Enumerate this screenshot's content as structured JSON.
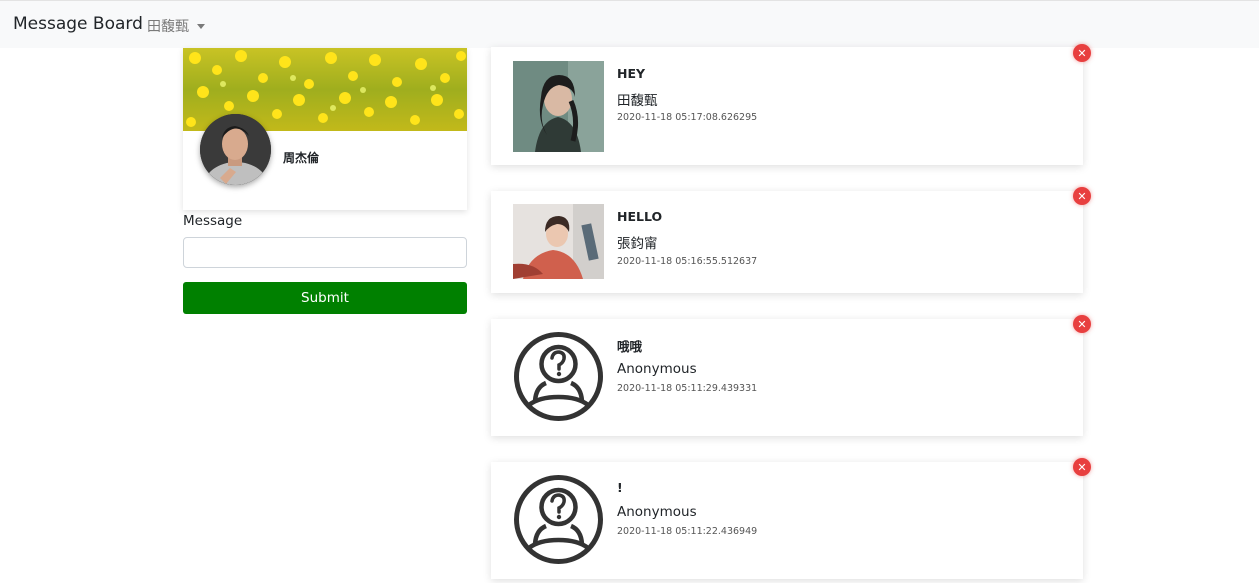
{
  "navbar": {
    "brand": "Message Board",
    "user_dropdown": "田馥甄"
  },
  "profile": {
    "name": "周杰倫"
  },
  "form": {
    "message_label": "Message",
    "message_value": "",
    "submit_label": "Submit"
  },
  "posts": [
    {
      "title": "HEY",
      "author": "田馥甄",
      "timestamp": "2020-11-18 05:17:08.626295",
      "avatar": "photo-woman-teal"
    },
    {
      "title": "HELLO",
      "author": "張鈞甯",
      "timestamp": "2020-11-18 05:16:55.512637",
      "avatar": "photo-woman-red"
    },
    {
      "title": "哦哦",
      "author": "Anonymous",
      "timestamp": "2020-11-18 05:11:29.439331",
      "avatar": "anonymous-user-icon"
    },
    {
      "title": "!",
      "author": "Anonymous",
      "timestamp": "2020-11-18 05:11:22.436949",
      "avatar": "anonymous-user-icon"
    }
  ],
  "colors": {
    "submit": "#008000",
    "delete": "#e83f3f",
    "navbar_bg": "#f8f9fa"
  }
}
